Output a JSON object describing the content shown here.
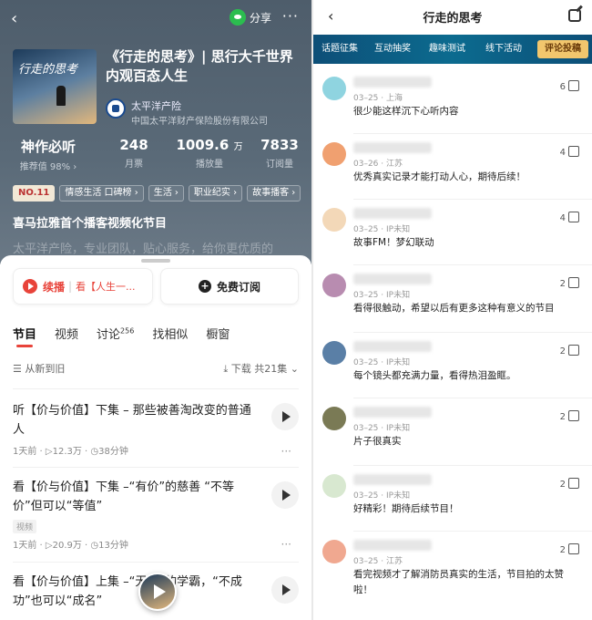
{
  "left": {
    "header": {
      "share": "分享",
      "more": "···"
    },
    "cover_text": "行走的思考",
    "title": "《行走的思考》| 思行大千世界 内观百态人生",
    "publisher": {
      "name": "太平洋产险",
      "full": "中国太平洋财产保险股份有限公司"
    },
    "stats": [
      {
        "value": "神作必听",
        "label": "推荐值 98% ›"
      },
      {
        "value": "248",
        "label": "月票"
      },
      {
        "value": "1009.6",
        "unit": "万",
        "label": "播放量"
      },
      {
        "value": "7833",
        "label": "订阅量"
      }
    ],
    "tags": [
      "NO.11",
      "情感生活 口碑榜 ›",
      "生活 ›",
      "职业纪实 ›",
      "故事播客 ›"
    ],
    "subtitle": "喜马拉雅首个播客视频化节目",
    "faded_text": "太平洋产险，专业团队，贴心服务，给你更优质的",
    "play": {
      "label": "续播",
      "sep": "|",
      "episode": "看【人生一..."
    },
    "subscribe": "免费订阅",
    "tabs": [
      {
        "label": "节目"
      },
      {
        "label": "视频"
      },
      {
        "label": "讨论",
        "sup": "256"
      },
      {
        "label": "找相似"
      },
      {
        "label": "橱窗"
      }
    ],
    "sort": {
      "order": "从新到旧",
      "download": "下载",
      "count": "共21集 ⌄"
    },
    "episodes": [
      {
        "title": "听【价与价值】下集 – 那些被善淘改变的普通人",
        "meta": "1天前 · ▷12.3万 · ◷38分钟"
      },
      {
        "title": "看【价与价值】下集 –“有价”的慈善 “不等价”但可以“等值”",
        "badge": "视频",
        "meta": "1天前 · ▷20.9万 · ◷13分钟"
      },
      {
        "title": "看【价与价值】上集 –“无价”的学霸，“不成功”也可以“成名”",
        "meta": ""
      }
    ]
  },
  "right": {
    "title": "行走的思考",
    "tabs": [
      "话题征集",
      "互动抽奖",
      "趣味测试",
      "线下活动",
      "评论投稿"
    ],
    "comments": [
      {
        "meta": "03–25 · 上海",
        "likes": "6",
        "text": "很少能这样沉下心听内容",
        "color": "#8fd4e0"
      },
      {
        "meta": "03–26 · 江苏",
        "likes": "4",
        "text": "优秀真实记录才能打动人心，期待后续！",
        "color": "#f0a070"
      },
      {
        "meta": "03–25 · IP未知",
        "likes": "4",
        "text": "故事FM！梦幻联动",
        "color": "#f3d8b8"
      },
      {
        "meta": "03–25 · IP未知",
        "likes": "2",
        "text": "看得很触动，希望以后有更多这种有意义的节目",
        "color": "#b88cb0"
      },
      {
        "meta": "03–25 · IP未知",
        "likes": "2",
        "text": "每个镜头都充满力量，看得热泪盈眶。",
        "color": "#5a7fa6"
      },
      {
        "meta": "03–25 · IP未知",
        "likes": "2",
        "text": "片子很真实",
        "color": "#7a7a55"
      },
      {
        "meta": "03–25 · IP未知",
        "likes": "2",
        "text": "好精彩！期待后续节目！",
        "color": "#d8e8d0"
      },
      {
        "meta": "03–25 · 江苏",
        "likes": "2",
        "text": "看完视频才了解消防员真实的生活，节目拍的太赞啦！",
        "color": "#f0a890"
      }
    ]
  }
}
